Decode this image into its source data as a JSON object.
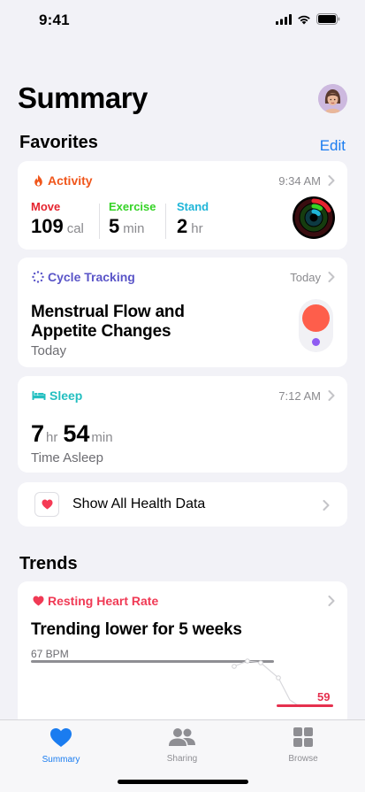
{
  "status": {
    "time": "9:41"
  },
  "page_title": "Summary",
  "favorites": {
    "header": "Favorites",
    "edit_label": "Edit",
    "activity": {
      "title": "Activity",
      "time": "9:34 AM",
      "move": {
        "label": "Move",
        "value": "109",
        "unit": "cal",
        "color": "#e5242f"
      },
      "exercise": {
        "label": "Exercise",
        "value": "5",
        "unit": "min",
        "color": "#35d326"
      },
      "stand": {
        "label": "Stand",
        "value": "2",
        "unit": "hr",
        "color": "#1fb5d8"
      }
    },
    "cycle": {
      "title": "Cycle Tracking",
      "time": "Today",
      "headline_line1": "Menstrual Flow and",
      "headline_line2": "Appetite Changes",
      "sub": "Today"
    },
    "sleep": {
      "title": "Sleep",
      "time": "7:12 AM",
      "hours": "7",
      "hours_unit": "hr",
      "minutes": "54",
      "minutes_unit": "min",
      "sub": "Time Asleep"
    },
    "show_all": "Show All Health Data"
  },
  "trends": {
    "header": "Trends",
    "heart": {
      "title": "Resting Heart Rate",
      "headline": "Trending lower for 5 weeks",
      "baseline_label": "67 BPM",
      "current_value": "59"
    }
  },
  "tabs": [
    {
      "label": "Summary",
      "active": true
    },
    {
      "label": "Sharing",
      "active": false
    },
    {
      "label": "Browse",
      "active": false
    }
  ],
  "colors": {
    "activity": "#f0561b",
    "cycle": "#5a55c8",
    "sleep": "#23bfc0",
    "heart": "#f03a55",
    "accent": "#1a7cf0"
  }
}
